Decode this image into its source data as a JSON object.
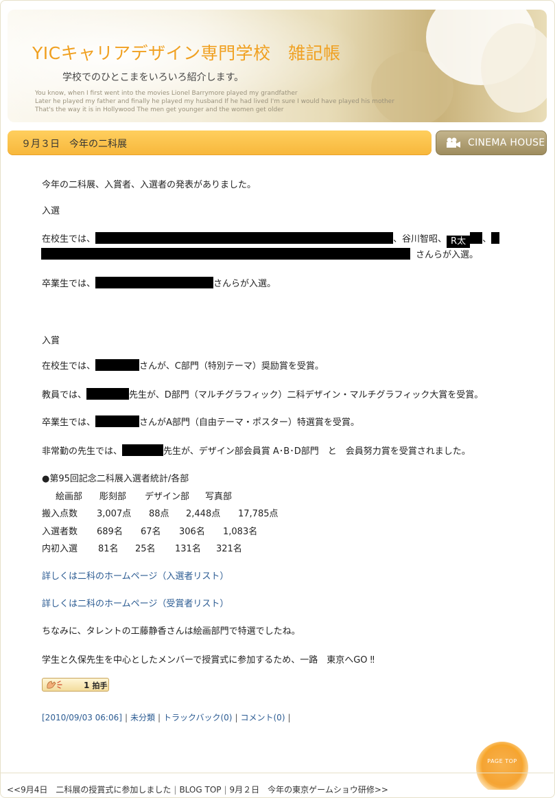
{
  "header": {
    "title": "YICキャリアデザイン専門学校　雑記帳",
    "subtitle": "学校でのひとこまをいろいろ紹介します。",
    "quote_lines": [
      "You know, when I first went into the movies Lionel Barrymore played my grandfather",
      "Later he played my father and finally he played my husband   If he had lived I'm sure I would have played his mother",
      "That's the way it is in Hollywood   The men get younger and the women get older"
    ]
  },
  "entry": {
    "title": "９月３日　今年の二科展",
    "cinema_label": "CINEMA HOUSE",
    "intro": "今年の二科展、入賞者、入選者の発表がありました。",
    "nyusen_heading": "入選",
    "zaikou_nyusen_prefix": "在校生では、",
    "zaikou_nyusen_mid": "、谷川智昭、",
    "redacted_tag": "R太",
    "zaikou_nyusen_sep": "、",
    "zaikou_nyusen_suffix": "さんらが入選。",
    "sotsugyo_nyusen_prefix": "卒業生では、",
    "sotsugyo_nyusen_suffix": "さんらが入選。",
    "nyusho_heading": "入賞",
    "zaikou_nyusho_prefix": "在校生では、",
    "zaikou_nyusho_suffix": "さんが、C部門（特別テーマ）奨励賞を受賞。",
    "kyoin_prefix": "教員では、",
    "kyoin_suffix": "先生が、D部門（マルチグラフィック）二科デザイン・マルチグラフィック大賞を受賞。",
    "sotsugyo_nyusho_prefix": "卒業生では、",
    "sotsugyo_nyusho_suffix": "さんがA部門（自由テーマ・ポスター）特選賞を受賞。",
    "hijokin_prefix": "非常勤の先生では、",
    "hijokin_suffix": "先生が、デザイン部会員賞 A･B･D部門　と　会員努力賞を受賞されました。",
    "stats_heading": "●第95回記念二科展入選者統計/各部",
    "stats_columns": [
      "絵画部",
      "彫刻部",
      "デザイン部",
      "写真部"
    ],
    "stats_rows": [
      {
        "label": "搬入点数",
        "values": [
          "3,007点",
          "88点",
          "2,448点",
          "17,785点"
        ]
      },
      {
        "label": "入選者数",
        "values": [
          "689名",
          "67名",
          "306名",
          "1,083名"
        ]
      },
      {
        "label": "内初入選",
        "values": [
          "81名",
          "25名",
          "131名",
          "321名"
        ]
      }
    ],
    "link1": "詳しくは二科のホームページ（入選者リスト）",
    "link2": "詳しくは二科のホームページ（受賞者リスト）",
    "note1": "ちなみに、タレントの工藤静香さんは絵画部門で特選でしたね。",
    "note2": "学生と久保先生を中心としたメンバーで授賞式に参加するため、一路　東京へGO ‼",
    "clap_count": "1",
    "clap_label": "拍手"
  },
  "meta": {
    "datetime": "[2010/09/03 06:06]",
    "category": "未分類",
    "trackback": "トラックバック(0)",
    "comment": "コメント(0)"
  },
  "page_top_label": "PAGE TOP",
  "footer": {
    "prev": "<<9月4日　二科展の授賞式に参加しました",
    "blog_top": "BLOG TOP",
    "next": "9月２日　今年の東京ゲームショウ研修>>"
  }
}
